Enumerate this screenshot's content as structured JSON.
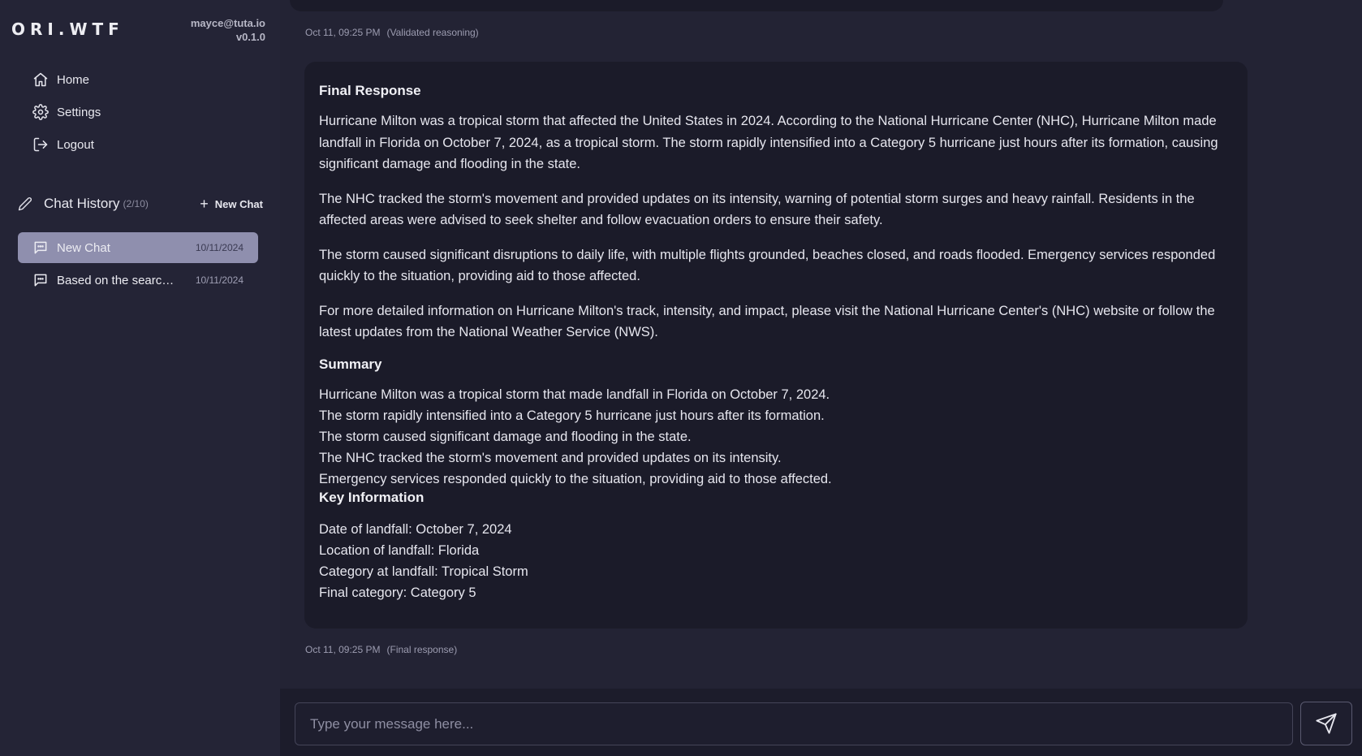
{
  "app": {
    "brand": "ORI.WTF",
    "user_email": "mayce@tuta.io",
    "version": "v0.1.0"
  },
  "nav": {
    "items": [
      {
        "label": "Home",
        "icon": "home-icon"
      },
      {
        "label": "Settings",
        "icon": "gear-icon"
      },
      {
        "label": "Logout",
        "icon": "logout-icon"
      }
    ]
  },
  "history": {
    "title": "Chat History",
    "count": "(2/10)",
    "new_chat_label": "New Chat",
    "chats": [
      {
        "label": "New Chat",
        "date": "10/11/2024",
        "active": true
      },
      {
        "label": "Based on the search results, it appears",
        "date": "10/11/2024",
        "active": false
      }
    ]
  },
  "messages": {
    "prev_meta": {
      "time": "Oct 11, 09:25 PM",
      "kind": "(Validated reasoning)"
    },
    "final": {
      "heading": "Final Response",
      "paragraphs": [
        "Hurricane Milton was a tropical storm that affected the United States in 2024. According to the National Hurricane Center (NHC), Hurricane Milton made landfall in Florida on October 7, 2024, as a tropical storm. The storm rapidly intensified into a Category 5 hurricane just hours after its formation, causing significant damage and flooding in the state.",
        "The NHC tracked the storm's movement and provided updates on its intensity, warning of potential storm surges and heavy rainfall. Residents in the affected areas were advised to seek shelter and follow evacuation orders to ensure their safety.",
        "The storm caused significant disruptions to daily life, with multiple flights grounded, beaches closed, and roads flooded. Emergency services responded quickly to the situation, providing aid to those affected.",
        "For more detailed information on Hurricane Milton's track, intensity, and impact, please visit the National Hurricane Center's (NHC) website or follow the latest updates from the National Weather Service (NWS)."
      ],
      "summary_heading": "Summary",
      "summary_lines": [
        "Hurricane Milton was a tropical storm that made landfall in Florida on October 7, 2024.",
        "The storm rapidly intensified into a Category 5 hurricane just hours after its formation.",
        "The storm caused significant damage and flooding in the state.",
        "The NHC tracked the storm's movement and provided updates on its intensity.",
        "Emergency services responded quickly to the situation, providing aid to those affected."
      ],
      "key_heading": "Key Information",
      "key_lines": [
        "Date of landfall: October 7, 2024",
        "Location of landfall: Florida",
        "Category at landfall: Tropical Storm",
        "Final category: Category 5"
      ],
      "meta": {
        "time": "Oct 11, 09:25 PM",
        "kind": "(Final response)"
      }
    }
  },
  "composer": {
    "placeholder": "Type your message here...",
    "value": ""
  },
  "colors": {
    "sidebar_bg": "#242436",
    "main_bg": "#232334",
    "bubble_bg": "#1b1b29",
    "active_chat": "#8f8fae"
  }
}
